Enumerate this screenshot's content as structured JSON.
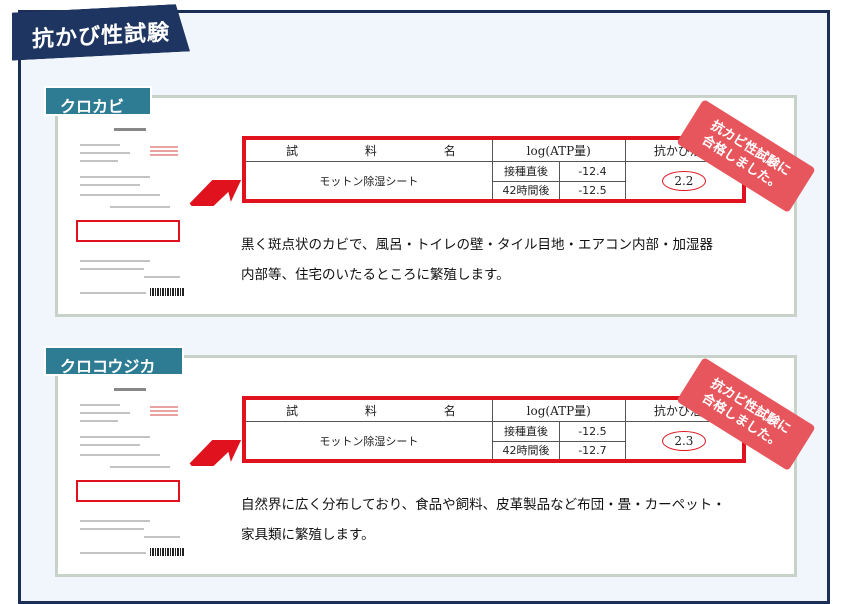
{
  "title": "抗かび性試験",
  "sections": [
    {
      "label": "クロカビ",
      "table": {
        "header_name": [
          "試",
          "料",
          "名"
        ],
        "header_log": "log(ATP量)",
        "header_result": "抗かび活性",
        "sample": "モットン除湿シート",
        "rows": [
          {
            "time": "接種直後",
            "value": "-12.4"
          },
          {
            "time": "42時間後",
            "value": "-12.5"
          }
        ],
        "result": "2.2"
      },
      "stamp": [
        "抗カビ性試験に",
        "合格しました。"
      ],
      "description": [
        "黒く斑点状のカビで、風呂・トイレの壁・タイル目地・エアコン内部・加湿器",
        "内部等、住宅のいたるところに繁殖します。"
      ]
    },
    {
      "label": "クロコウジカビ",
      "table": {
        "header_name": [
          "試",
          "料",
          "名"
        ],
        "header_log": "log(ATP量)",
        "header_result": "抗かび活性",
        "sample": "モットン除湿シート",
        "rows": [
          {
            "time": "接種直後",
            "value": "-12.5"
          },
          {
            "time": "42時間後",
            "value": "-12.7"
          }
        ],
        "result": "2.3"
      },
      "stamp": [
        "抗カビ性試験に",
        "合格しました。"
      ],
      "description": [
        "自然界に広く分布しており、食品や飼料、皮革製品など布団・畳・カーペット・",
        "家具類に繁殖します。"
      ]
    }
  ],
  "colors": {
    "frame": "#1a2e57",
    "label": "#2e7c93",
    "accent_red": "#e0121d",
    "stamp": "#e8565d"
  }
}
